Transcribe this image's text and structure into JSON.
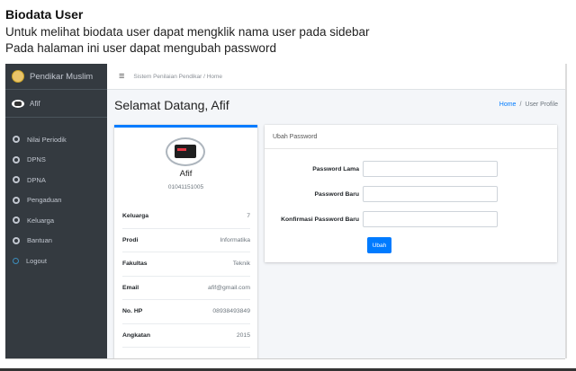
{
  "doc": {
    "heading": "Biodata User",
    "line1": "Untuk melihat biodata user dapat mengklik nama user pada sidebar",
    "line2": "Pada halaman ini user dapat mengubah password"
  },
  "sidebar": {
    "brand": "Pendikar Muslim",
    "user_name": "Afif",
    "items": [
      {
        "label": "Nilai Periodik",
        "icon": "dashboard-icon"
      },
      {
        "label": "DPNS",
        "icon": "dashboard-icon"
      },
      {
        "label": "DPNA",
        "icon": "dashboard-icon"
      },
      {
        "label": "Pengaduan",
        "icon": "dashboard-icon"
      },
      {
        "label": "Keluarga",
        "icon": "dashboard-icon"
      },
      {
        "label": "Bantuan",
        "icon": "dashboard-icon"
      },
      {
        "label": "Logout",
        "icon": "circle-icon"
      }
    ]
  },
  "topbar": {
    "menu_icon": "≡",
    "breadcrumb": "Sistem Penilaian Pendikar / Home"
  },
  "content": {
    "title": "Selamat Datang, Afif",
    "breadcrumb_home": "Home",
    "breadcrumb_sep": "/",
    "breadcrumb_current": "User Profile"
  },
  "profile": {
    "name": "Afif",
    "id": "01041151005",
    "fields": [
      {
        "label": "Keluarga",
        "value": "7"
      },
      {
        "label": "Prodi",
        "value": "Informatika"
      },
      {
        "label": "Fakultas",
        "value": "Teknik"
      },
      {
        "label": "Email",
        "value": "afif@gmail.com"
      },
      {
        "label": "No. HP",
        "value": "08938493849"
      },
      {
        "label": "Angkatan",
        "value": "2015"
      }
    ]
  },
  "password_form": {
    "header": "Ubah Password",
    "old_label": "Password Lama",
    "old_value": "",
    "new_label": "Password Baru",
    "new_value": "",
    "confirm_label": "Konfirmasi Password Baru",
    "confirm_value": "",
    "submit_label": "Ubah"
  },
  "colors": {
    "sidebar_bg": "#343a40",
    "accent": "#007bff"
  }
}
